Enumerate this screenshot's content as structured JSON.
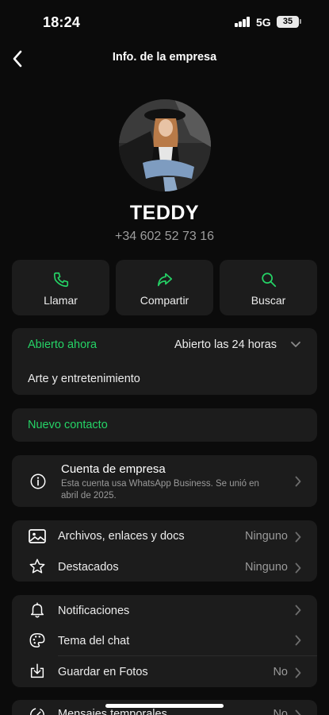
{
  "status_bar": {
    "time": "18:24",
    "network": "5G",
    "battery": "35"
  },
  "nav": {
    "title": "Info. de la empresa"
  },
  "contact": {
    "name": "TEDDY",
    "phone": "+34 602 52 73 16"
  },
  "actions": [
    {
      "label": "Llamar",
      "icon": "phone-icon"
    },
    {
      "label": "Compartir",
      "icon": "share-icon"
    },
    {
      "label": "Buscar",
      "icon": "search-icon"
    }
  ],
  "hours": {
    "status": "Abierto ahora",
    "detail": "Abierto las 24 horas",
    "category": "Arte y entretenimiento"
  },
  "new_contact": {
    "label": "Nuevo contacto"
  },
  "business_account": {
    "title": "Cuenta de empresa",
    "description_line1": "Esta cuenta usa WhatsApp Business. Se unió en",
    "description_line2": "abril de 2025."
  },
  "media": [
    {
      "label": "Archivos, enlaces y docs",
      "value": "Ninguno",
      "icon": "photo-icon"
    },
    {
      "label": "Destacados",
      "value": "Ninguno",
      "icon": "star-icon"
    }
  ],
  "settings": [
    {
      "label": "Notificaciones",
      "value": "",
      "icon": "bell-icon"
    },
    {
      "label": "Tema del chat",
      "value": "",
      "icon": "palette-icon"
    },
    {
      "label": "Guardar en Fotos",
      "value": "No",
      "icon": "save-to-photos-icon"
    }
  ],
  "partial_row": {
    "label": "Mensajes temporales",
    "value": "No",
    "icon": "timer-icon"
  },
  "colors": {
    "accent": "#25d366",
    "background": "#0b0b0b",
    "card": "#1c1c1c",
    "secondary_text": "#9a9a9a"
  }
}
